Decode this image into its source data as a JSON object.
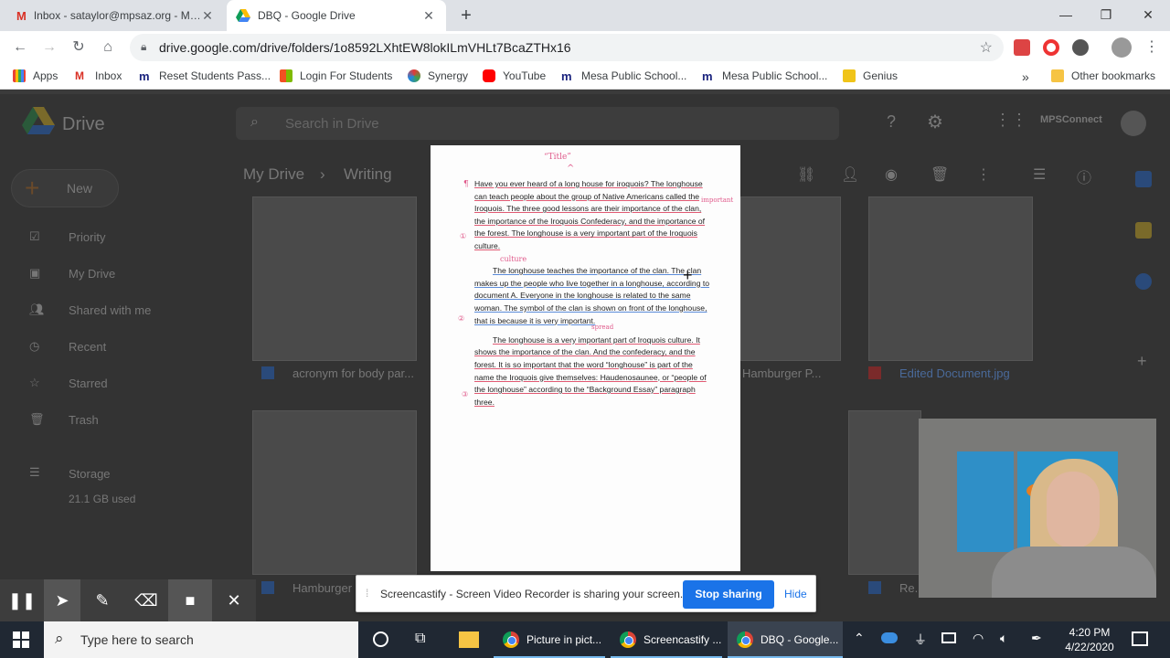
{
  "tabs": [
    {
      "title": "Inbox - sataylor@mpsaz.org - M…",
      "active": false
    },
    {
      "title": "DBQ - Google Drive",
      "active": true
    }
  ],
  "address": {
    "url": "drive.google.com/drive/folders/1o8592LXhtEW8lokILmVHLt7BcaZTHx16"
  },
  "bookmarks": {
    "items": [
      "Apps",
      "Inbox",
      "Reset Students Pass...",
      "Login For Students",
      "Synergy",
      "YouTube",
      "Mesa Public School...",
      "Mesa Public School...",
      "Genius"
    ],
    "more": "»",
    "other": "Other bookmarks"
  },
  "drive": {
    "logo_text": "Drive",
    "search_placeholder": "Search in Drive",
    "breadcrumb": [
      "My Drive",
      "Writing"
    ],
    "new_label": "New",
    "nav": [
      "Priority",
      "My Drive",
      "Shared with me",
      "Recent",
      "Starred",
      "Trash",
      "Storage"
    ],
    "storage_used": "21.1 GB used",
    "account": "MPSConnect",
    "files": [
      "acronym for body par...",
      "Hamburger P...",
      "Edited Document.jpg",
      "Hamburger",
      "Re..."
    ]
  },
  "document": {
    "annotation_title": "“Title”",
    "annotation_culture": "culture",
    "annotation_important": "important",
    "annotation_spread": "spread",
    "para1": "Have you ever heard of a long house for iroquois?  The longhouse can teach people about the group of Native Americans called the Iroquois.  The three good lessons are their importance of the clan, the importance of the Iroquois Confederacy, and the importance of the forest.  The longhouse is a very important part of the Iroquois culture.",
    "para2": "The longhouse teaches the importance of the clan.  The clan makes up the people who live together in a longhouse, according to document A.  Everyone in the longhouse is related to the same woman.  The symbol of the clan is shown on front of the longhouse, that is because it is very important.",
    "para3": "The longhouse is a very important part of Iroquois culture.  It shows the importance of the clan. And the confederacy, and the forest.  It is so important that the word “longhouse” is part of the name the Iroquois give themselves: Haudenosaunee, or “people of the longhouse” according to the “Background Essay” paragraph three."
  },
  "screencastify": {
    "message": "Screencastify - Screen Video Recorder is sharing your screen.",
    "stop_label": "Stop sharing",
    "hide_label": "Hide"
  },
  "taskbar": {
    "search_placeholder": "Type here to search",
    "apps": [
      "Picture in pict...",
      "Screencastify ...",
      "DBQ - Google..."
    ],
    "time": "4:20 PM",
    "date": "4/22/2020"
  }
}
